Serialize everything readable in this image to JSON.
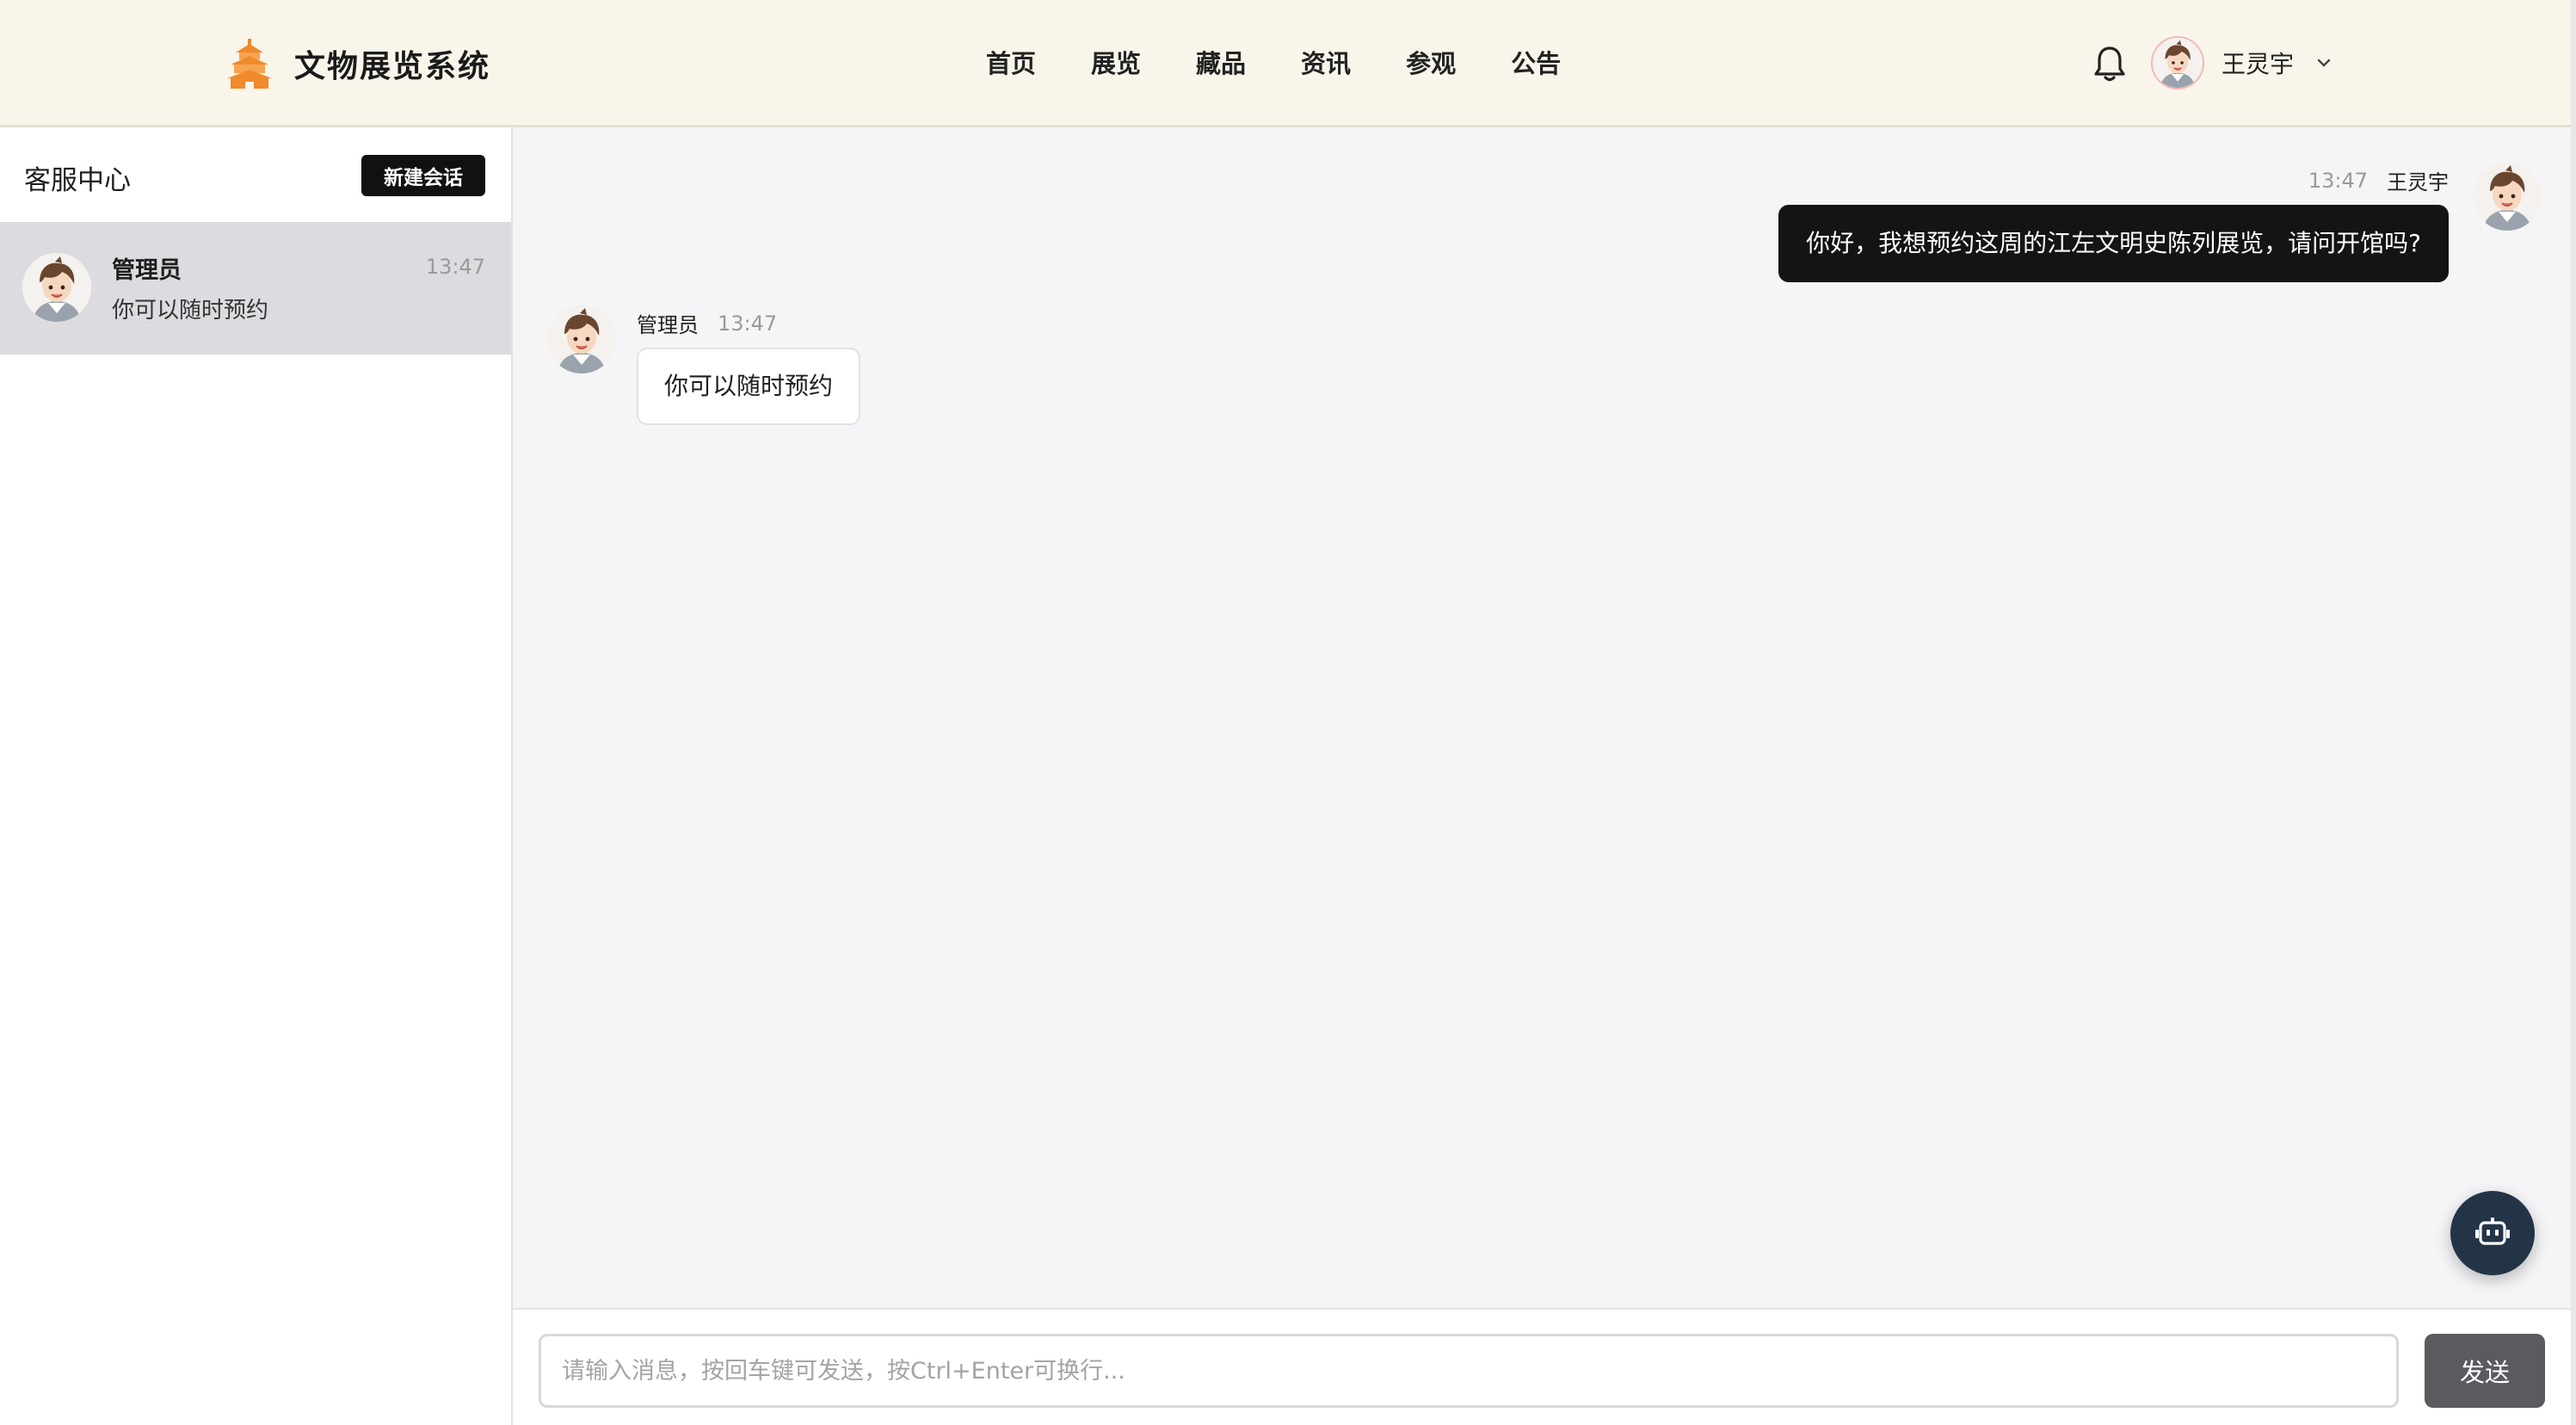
{
  "header": {
    "brand_name": "文物展览系统",
    "brand_icon": "pagoda-icon",
    "nav": [
      "首页",
      "展览",
      "藏品",
      "资讯",
      "参观",
      "公告"
    ],
    "user_name": "王灵宇"
  },
  "sidebar": {
    "title": "客服中心",
    "new_chat_label": "新建会话",
    "conversations": [
      {
        "name": "管理员",
        "time": "13:47",
        "preview": "你可以随时预约"
      }
    ]
  },
  "chat": {
    "messages": [
      {
        "side": "right",
        "sender": "王灵宇",
        "time": "13:47",
        "text": "你好，我想预约这周的江左文明史陈列展览，请问开馆吗?"
      },
      {
        "side": "left",
        "sender": "管理员",
        "time": "13:47",
        "text": "你可以随时预约"
      }
    ]
  },
  "input": {
    "placeholder": "请输入消息，按回车键可发送，按Ctrl+Enter可换行...",
    "value": "",
    "send_label": "发送"
  },
  "colors": {
    "header_bg": "#f9f5ea",
    "brand_accent": "#f08a2c",
    "dark_bubble": "#141414",
    "bot_button": "#233447",
    "send_button": "#5a5a60"
  }
}
